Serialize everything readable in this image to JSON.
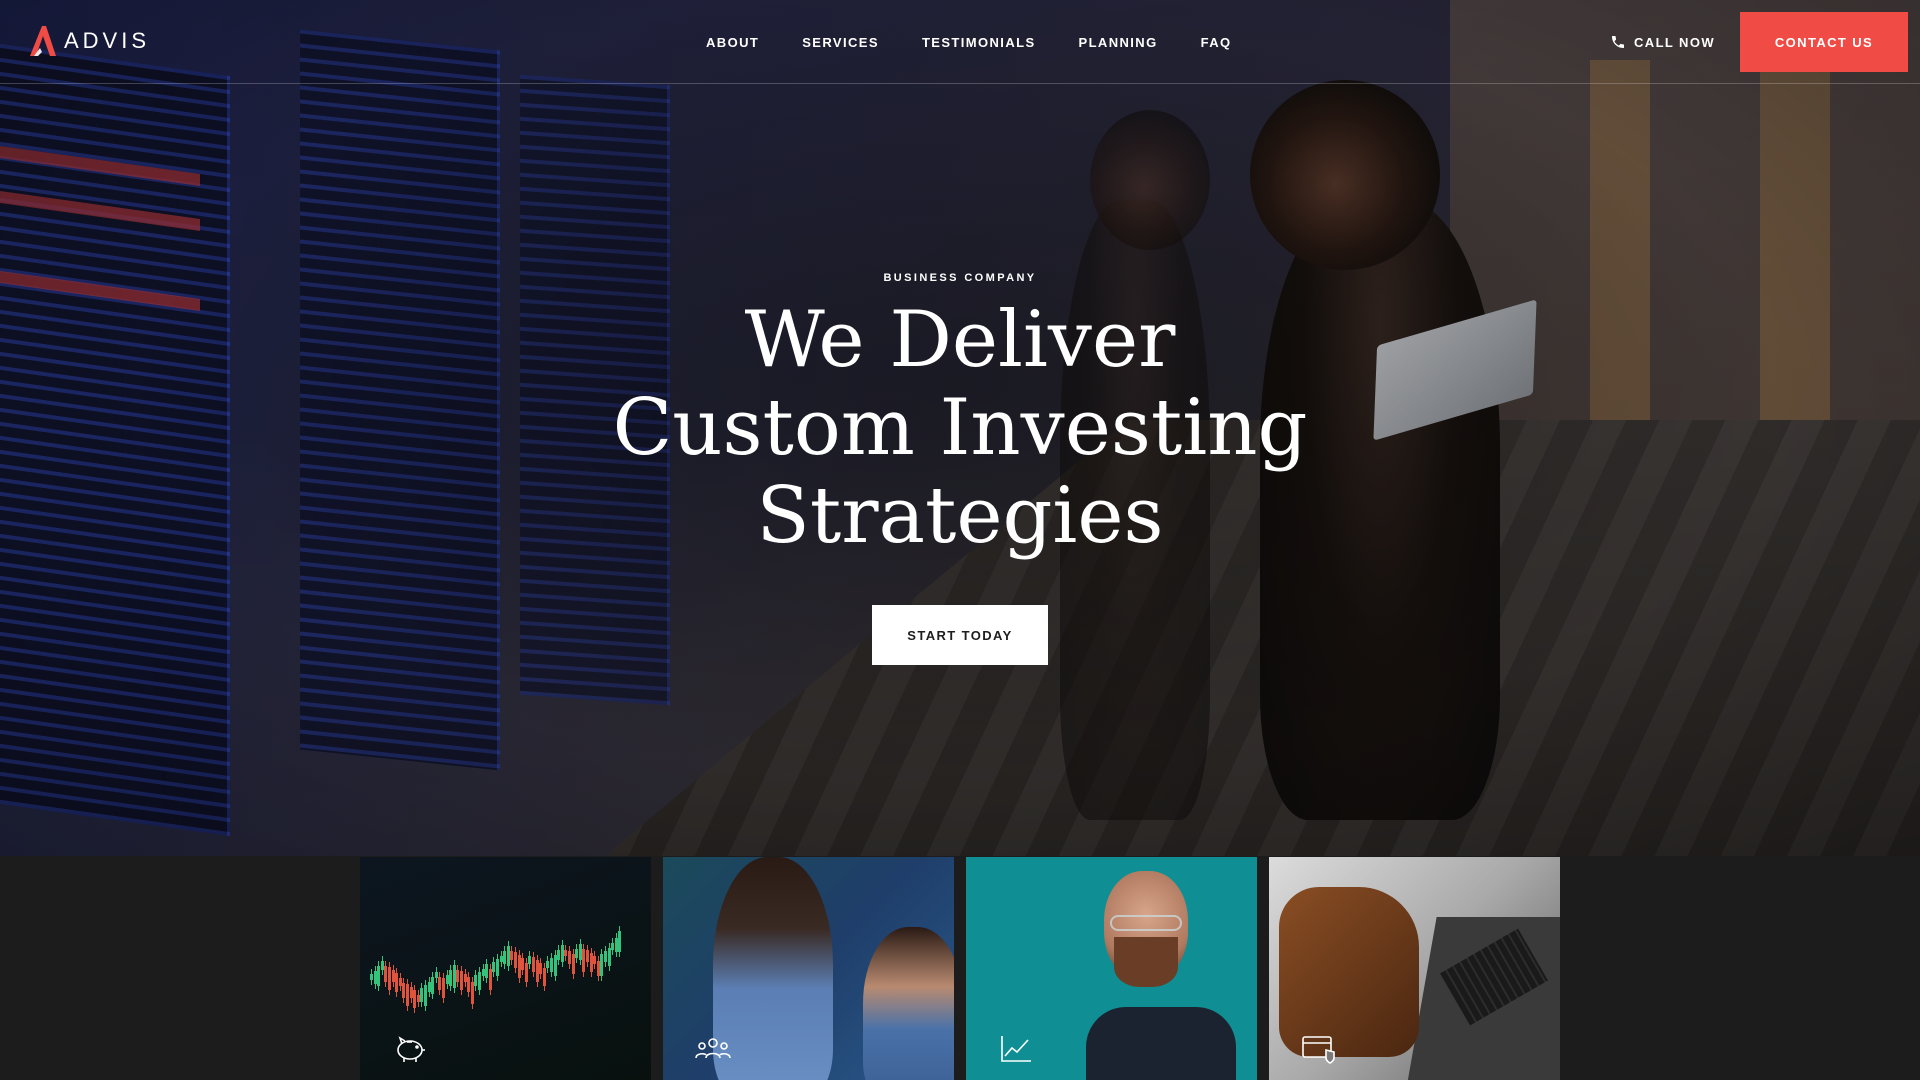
{
  "brand": {
    "name": "ADVIS",
    "accent_color": "#f04c45"
  },
  "nav": {
    "items": [
      {
        "label": "ABOUT"
      },
      {
        "label": "SERVICES"
      },
      {
        "label": "TESTIMONIALS"
      },
      {
        "label": "PLANNING"
      },
      {
        "label": "FAQ"
      }
    ]
  },
  "header_actions": {
    "call_label": "CALL NOW",
    "call_icon": "phone-icon",
    "contact_label": "CONTACT US"
  },
  "hero": {
    "eyebrow": "BUSINESS COMPANY",
    "headline_lines": [
      "We Deliver",
      "Custom Investing",
      "Strategies"
    ],
    "cta_label": "START TODAY"
  },
  "cards": [
    {
      "icon": "piggy-bank-icon",
      "image": "stock-chart-photo"
    },
    {
      "icon": "team-icon",
      "image": "two-women-photo"
    },
    {
      "icon": "line-chart-icon",
      "image": "man-portrait-photo"
    },
    {
      "icon": "card-shield-icon",
      "image": "office-chair-desk-photo"
    }
  ]
}
